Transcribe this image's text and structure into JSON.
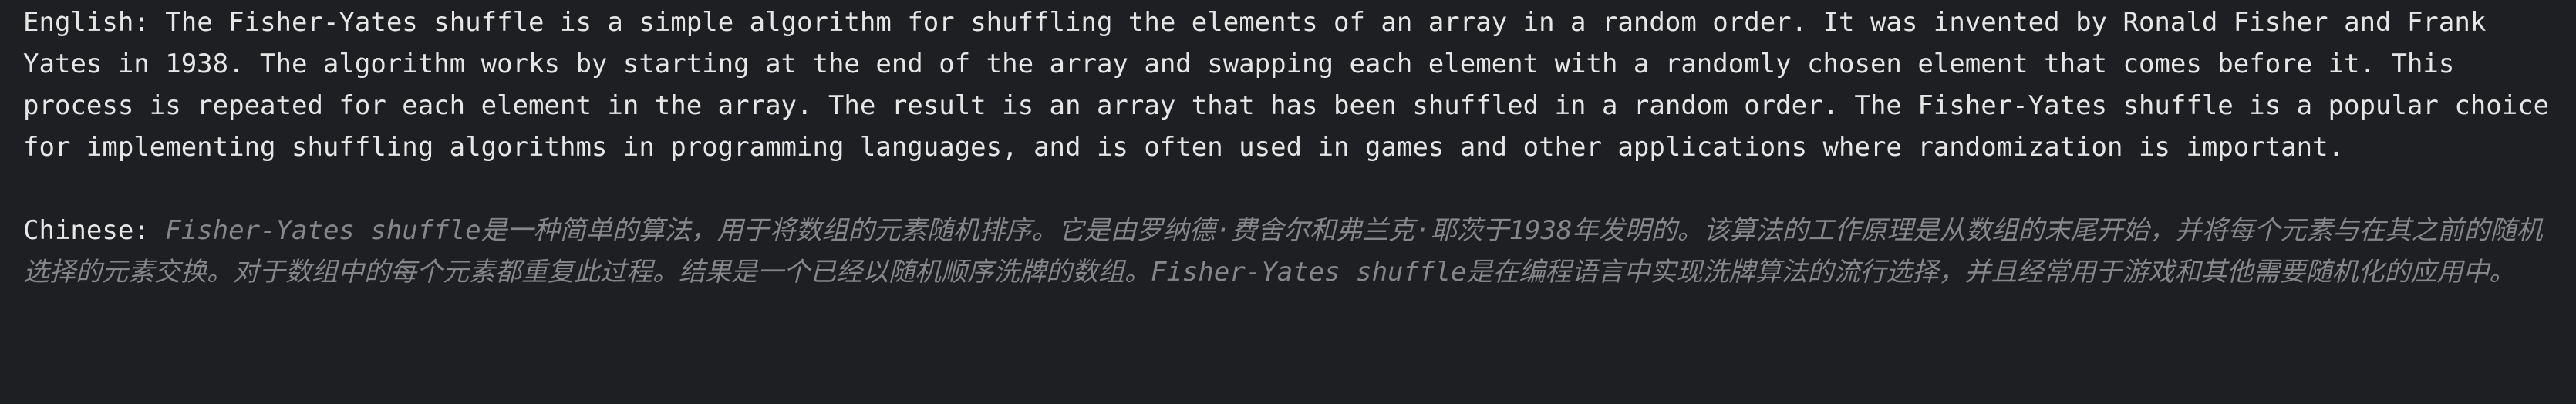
{
  "english": {
    "label": "English:",
    "text": "The Fisher-Yates shuffle is a simple algorithm for shuffling the elements of an array in a random order. It was invented by Ronald Fisher and Frank Yates in 1938. The algorithm works by starting at the end of the array and swapping each element with a randomly chosen element that comes before it. This process is repeated for each element in the array. The result is an array that has been shuffled in a random order. The Fisher-Yates shuffle is a popular choice for implementing shuffling algorithms in programming languages, and is often used in games and other applications where randomization is important."
  },
  "chinese": {
    "label": "Chinese:",
    "text": "Fisher-Yates shuffle是一种简单的算法，用于将数组的元素随机排序。它是由罗纳德·费舍尔和弗兰克·耶茨于1938年发明的。该算法的工作原理是从数组的末尾开始，并将每个元素与在其之前的随机选择的元素交换。对于数组中的每个元素都重复此过程。结果是一个已经以随机顺序洗牌的数组。Fisher-Yates shuffle是在编程语言中实现洗牌算法的流行选择，并且经常用于游戏和其他需要随机化的应用中。"
  }
}
